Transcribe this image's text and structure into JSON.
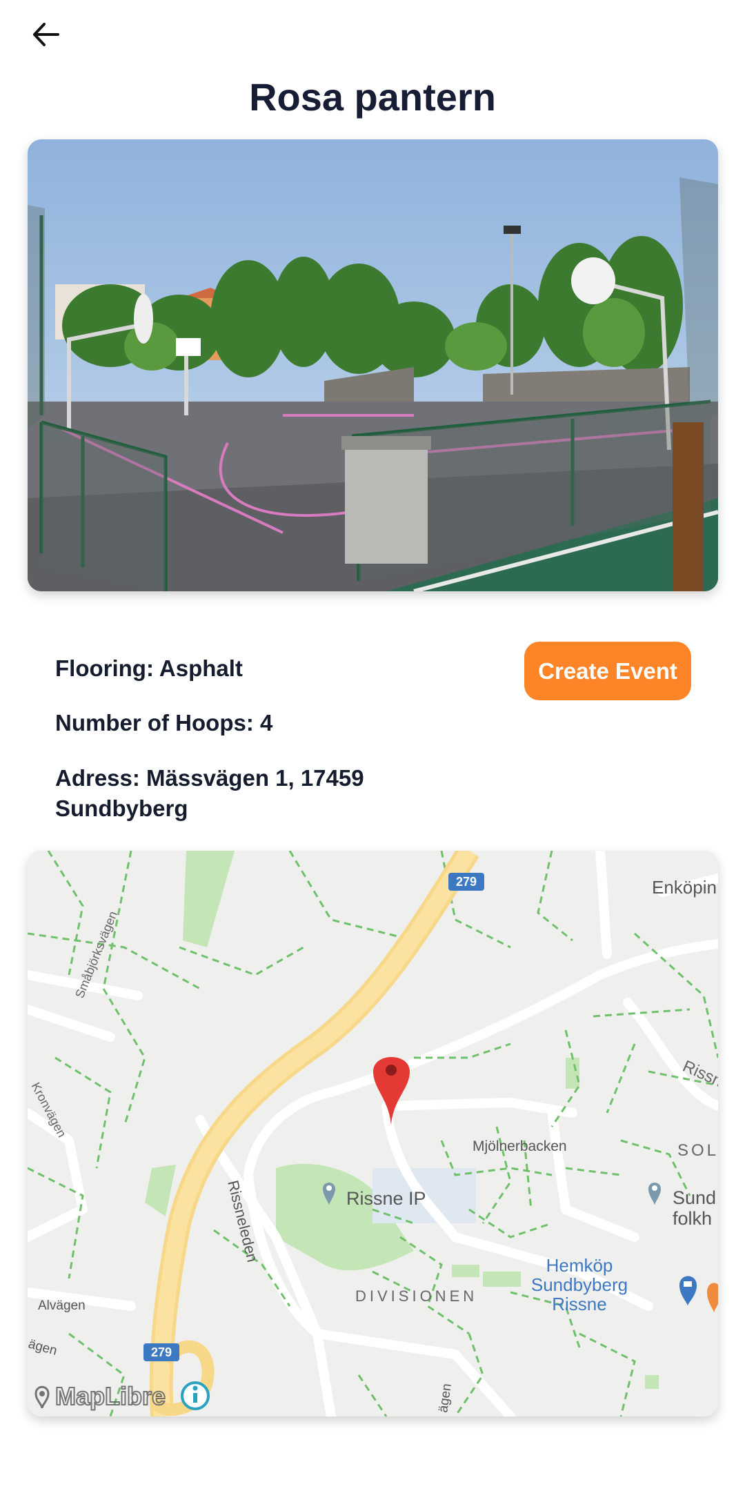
{
  "header": {
    "back_icon": "arrow-left-icon",
    "title": "Rosa pantern"
  },
  "court": {
    "photo_alt": "Outdoor basketball court with green fence and pink court lines",
    "flooring": "Flooring: Asphalt",
    "hoops": "Number of Hoops: 4",
    "address": "Adress: Mässvägen 1, 17459 Sundbyberg"
  },
  "actions": {
    "create_event_label": "Create Event",
    "create_event_color": "#fd8427"
  },
  "map": {
    "pin_icon": "map-pin-icon",
    "labels": {
      "enkoping": "Enköpin",
      "smabjorks": "Småbjörksvägen",
      "kronvagen": "Kronvägen",
      "rissne_road": "Rissn",
      "molnerbacken": "Mjölnerbacken",
      "sol": "SOL",
      "rissne_ip": "Rissne IP",
      "sund_folk_1": "Sund",
      "sund_folk_2": "folkh",
      "rissneleden": "Rissneleden",
      "hemkop_1": "Hemköp",
      "hemkop_2": "Sundbyberg",
      "hemkop_3": "Rissne",
      "divisionen": "DIVISIONEN",
      "alvagen": "Alvägen",
      "agen_left": "ägen",
      "agen_bottom": "ägen",
      "road_279_top": "279",
      "road_279_bottom": "279"
    },
    "attribution": "MapLibre",
    "info_icon": "info-icon"
  }
}
